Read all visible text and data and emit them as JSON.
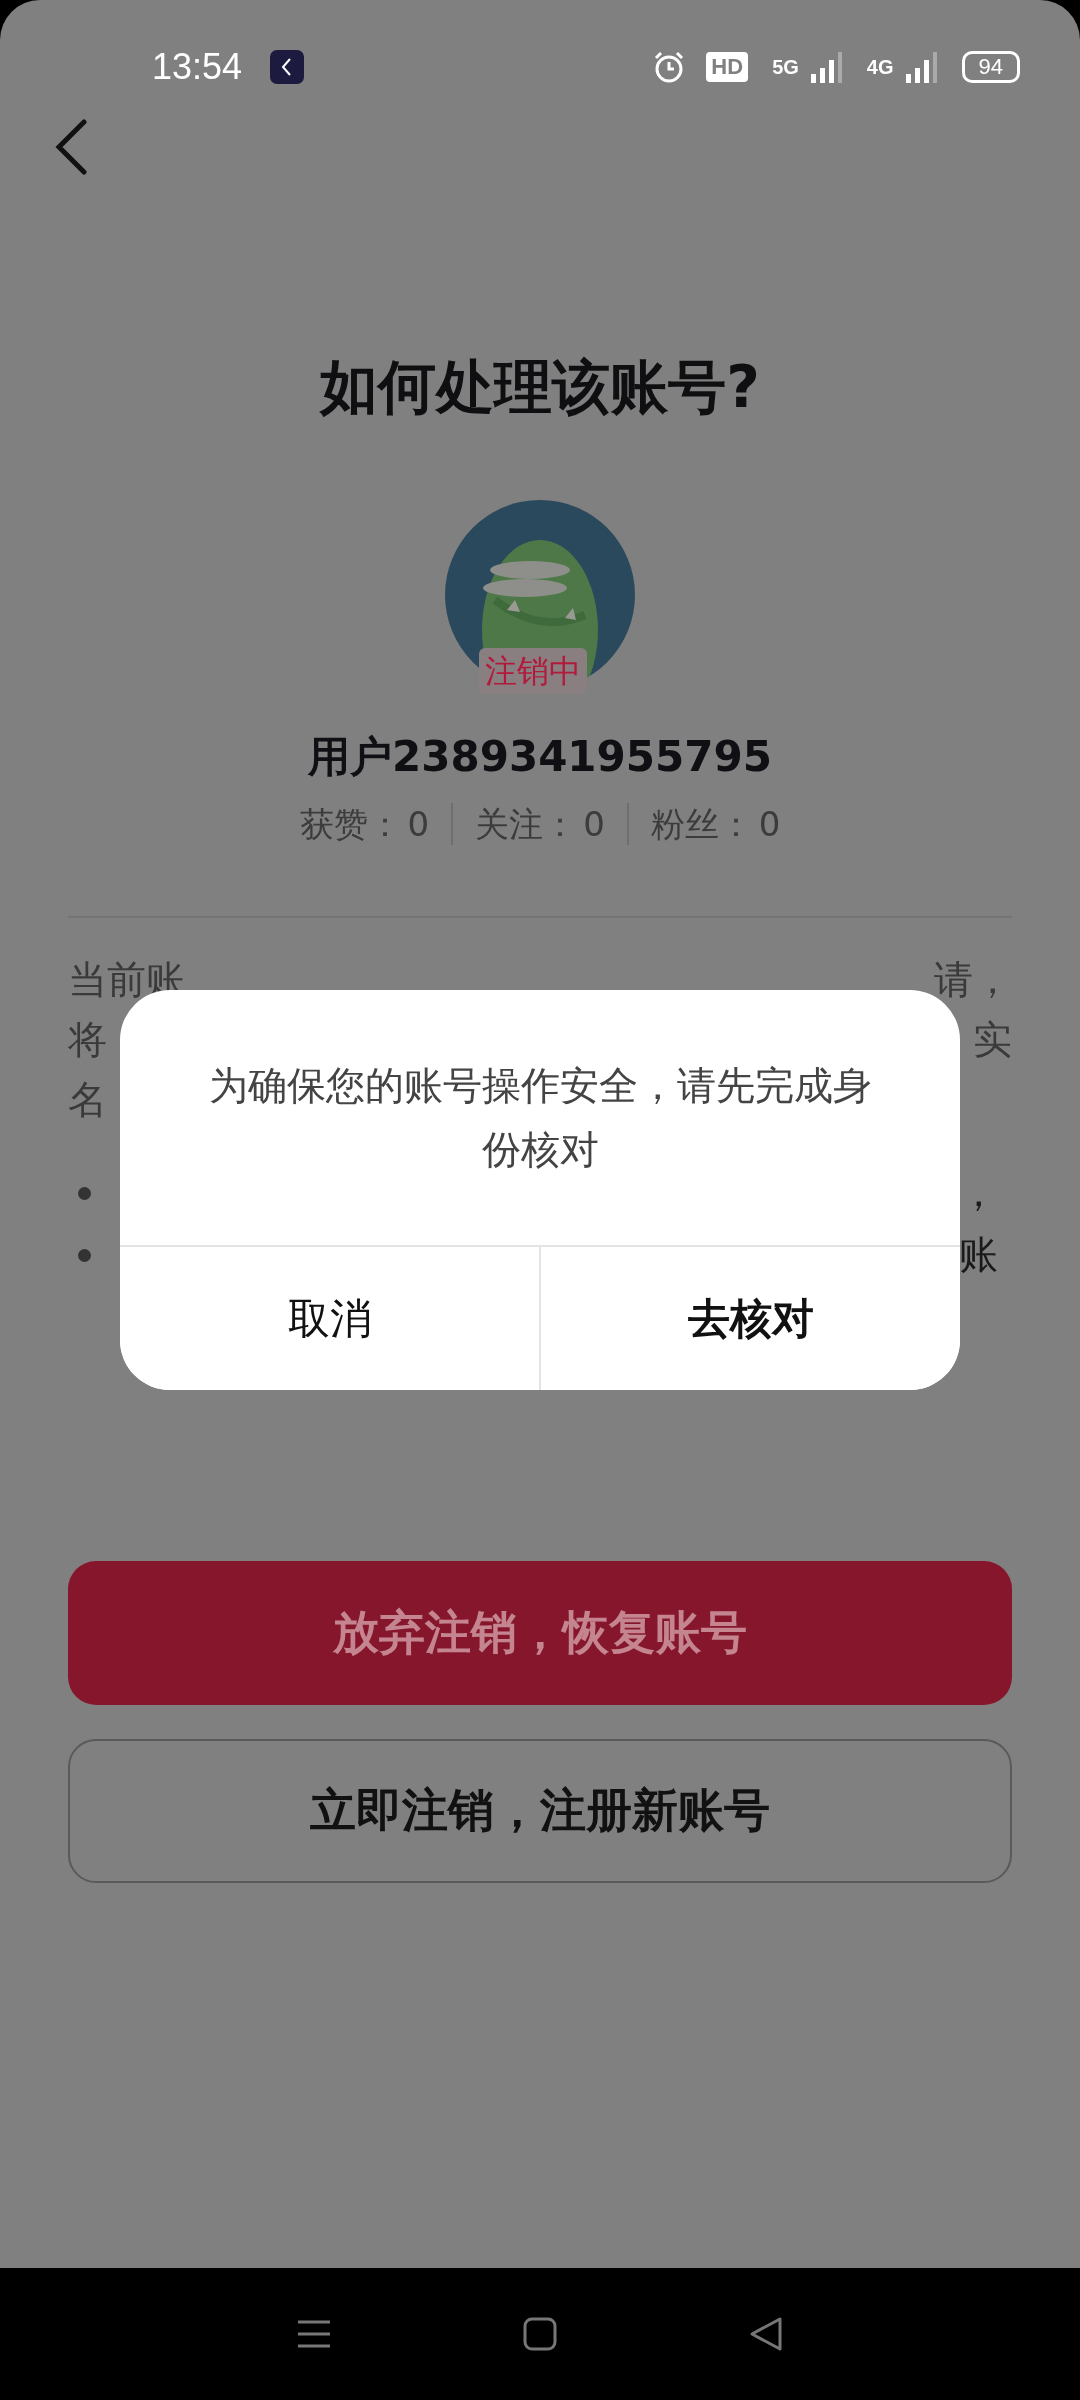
{
  "status_bar": {
    "time": "13:54",
    "hd": "HD",
    "network_1": "5G",
    "network_2": "4G",
    "battery": "94"
  },
  "title": "如何处理该账号?",
  "profile": {
    "badge": "注销中",
    "username": "用户2389341955795",
    "stats": [
      {
        "label": "获赞：",
        "value": "0"
      },
      {
        "label": "关注：",
        "value": "0"
      },
      {
        "label": "粉丝：",
        "value": "0"
      }
    ]
  },
  "notice": {
    "line_1_left": "当前账",
    "line_1_right": "请，",
    "line_2_left": "将",
    "line_2_right": "实",
    "line_3_left": "名",
    "bullets": [
      {
        "right": "，"
      },
      {
        "right": "账"
      }
    ]
  },
  "dialog": {
    "message": "为确保您的账号操作安全，请先完成身份核对",
    "buttons": [
      {
        "label": "取消",
        "emphasis": false
      },
      {
        "label": "去核对",
        "emphasis": true
      }
    ]
  },
  "actions": [
    {
      "label": "放弃注销，恢复账号",
      "kind": "filled"
    },
    {
      "label": "立即注销，注册新账号",
      "kind": "outline"
    }
  ]
}
